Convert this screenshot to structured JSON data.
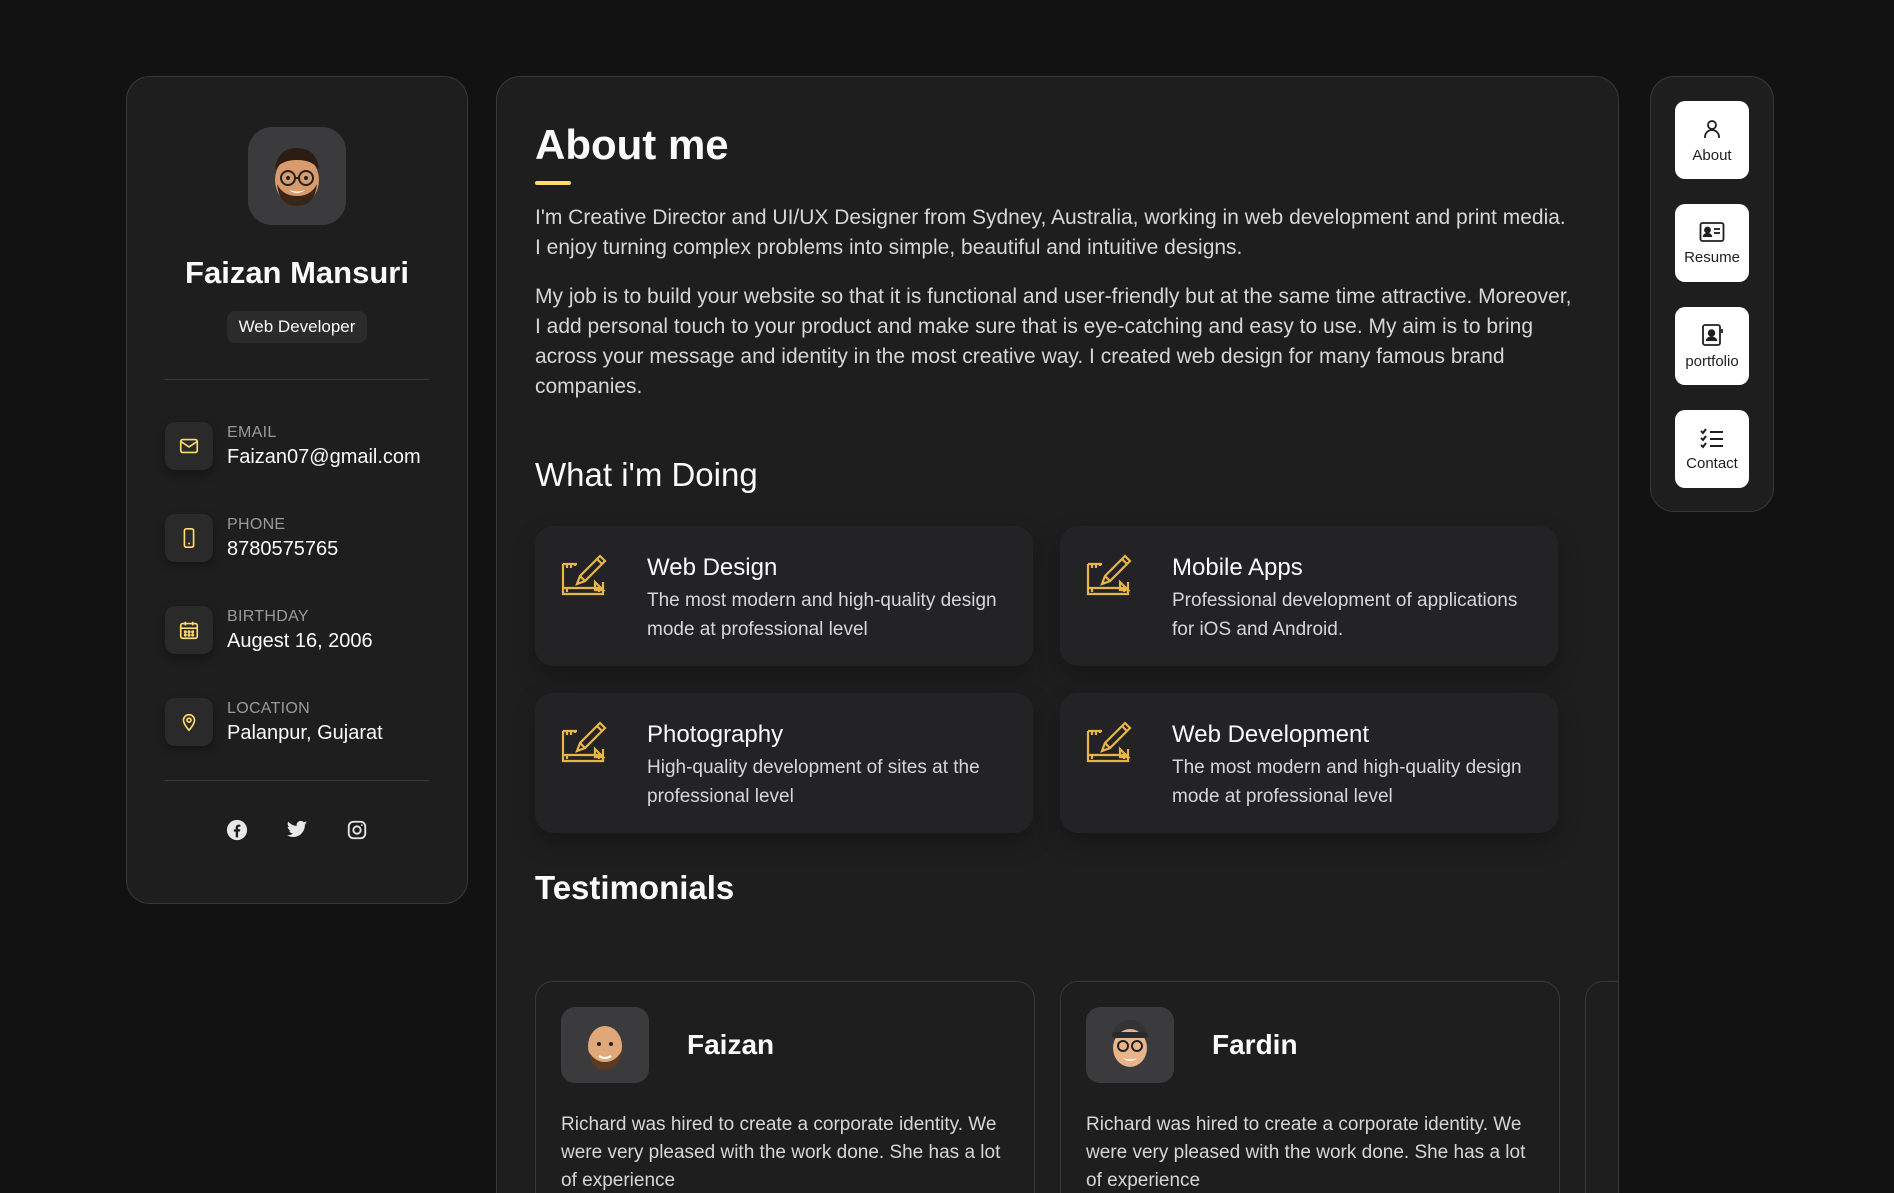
{
  "profile": {
    "name": "Faizan Mansuri",
    "title": "Web Developer",
    "contacts": [
      {
        "label": "Email",
        "value": "Faizan07@gmail.com",
        "icon": "mail-icon"
      },
      {
        "label": "Phone",
        "value": "8780575765",
        "icon": "phone-icon"
      },
      {
        "label": "Birthday",
        "value": "Augest 16, 2006",
        "icon": "calendar-icon"
      },
      {
        "label": "Location",
        "value": "Palanpur, Gujarat",
        "icon": "location-icon"
      }
    ],
    "socials": [
      "facebook-icon",
      "twitter-icon",
      "instagram-icon"
    ]
  },
  "about": {
    "title": "About me",
    "paragraphs": [
      "I'm Creative Director and UI/UX Designer from Sydney, Australia, working in web development and print media. I enjoy turning complex problems into simple, beautiful and intuitive designs.",
      "My job is to build your website so that it is functional and user-friendly but at the same time attractive. Moreover, I add personal touch to your product and make sure that is eye-catching and easy to use. My aim is to bring across your message and identity in the most creative way. I created web design for many famous brand companies."
    ]
  },
  "services": {
    "title": "What i'm Doing",
    "items": [
      {
        "title": "Web Design",
        "desc": "The most modern and high-quality design mode at professional level"
      },
      {
        "title": "Mobile Apps",
        "desc": "Professional development of applications for iOS and Android."
      },
      {
        "title": "Photography",
        "desc": "High-quality development of sites at the professional level"
      },
      {
        "title": "Web Development",
        "desc": "The most modern and high-quality design mode at professional level"
      }
    ]
  },
  "testimonials": {
    "title": "Testimonials",
    "items": [
      {
        "name": "Faizan",
        "text": "Richard was hired to create a corporate identity. We were very pleased with the work done. She has a lot of experience"
      },
      {
        "name": "Fardin",
        "text": "Richard was hired to create a corporate identity. We were very pleased with the work done. She has a lot of experience"
      }
    ]
  },
  "nav": [
    {
      "label": "About",
      "icon": "user-icon"
    },
    {
      "label": "Resume",
      "icon": "id-card-icon"
    },
    {
      "label": "portfolio",
      "icon": "portfolio-icon"
    },
    {
      "label": "Contact",
      "icon": "checklist-icon"
    }
  ],
  "colors": {
    "background": "#121213",
    "panel": "#1e1e1f",
    "accent": "#ffdb70",
    "text": "#fafafa"
  }
}
